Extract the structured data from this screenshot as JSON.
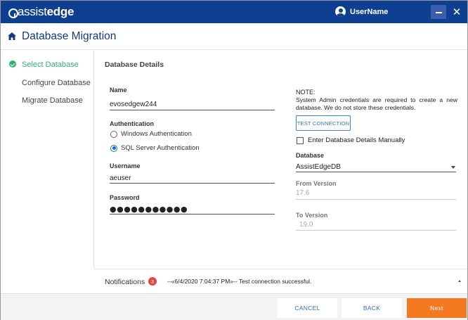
{
  "titlebar": {
    "logo_part1": "assist",
    "logo_part2": "edge",
    "user_name": "UserName",
    "minimize_label": "–",
    "close_label": "✕"
  },
  "header": {
    "title": "Database Migration"
  },
  "nav": {
    "items": [
      {
        "label": "Select Database",
        "active": true
      },
      {
        "label": "Configure Database",
        "active": false
      },
      {
        "label": "Migrate Database",
        "active": false
      }
    ]
  },
  "details": {
    "section_title": "Database Details",
    "name_label": "Name",
    "name_value": "evosedgew244",
    "auth_label": "Authentication",
    "auth_options": [
      {
        "label": "Windows Authentication",
        "selected": false
      },
      {
        "label": "SQL Server Authentication",
        "selected": true
      }
    ],
    "username_label": "Username",
    "username_value": "aeuser",
    "password_label": "Password",
    "password_value": "●●●●●●●●●●●"
  },
  "note": {
    "title": "NOTE:",
    "text": "System Admin credentials are required to create a new database. We do not store these credentials.",
    "test_button": "TEST CONNECTION",
    "manual_checkbox_label": "Enter Database Details Manually",
    "manual_checked": false,
    "database_label": "Database",
    "database_value": "AssistEdgeDB",
    "from_version_label": "From Version",
    "from_version_value": "17.6",
    "to_version_label": "To Version",
    "to_version_value": "19.0"
  },
  "notifications": {
    "label": "Notifications",
    "count": "3",
    "message": "--«6/4/2020 7:04:37 PM»-- Test connection successful."
  },
  "footer": {
    "cancel": "CANCEL",
    "back": "BACK",
    "next": "Next"
  },
  "colors": {
    "titlebar": "#0f3f91",
    "accent_green": "#2bb46b",
    "next_orange": "#f47920",
    "link_blue": "#2a6fc4",
    "badge_red": "#e64545"
  }
}
